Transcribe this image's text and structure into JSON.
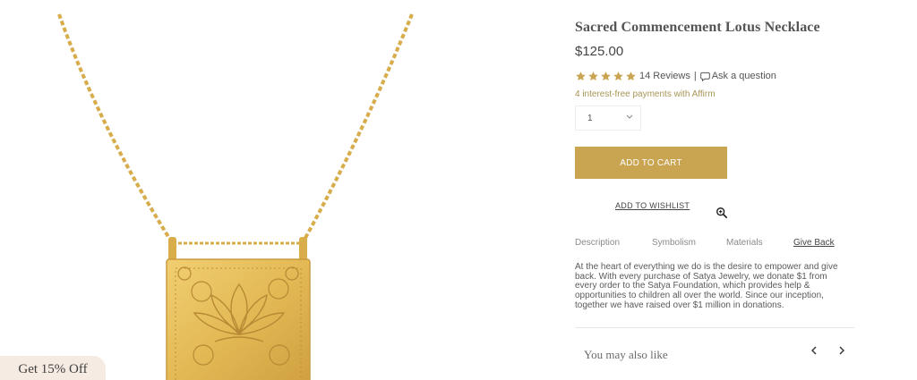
{
  "product": {
    "title": "Sacred Commencement Lotus Necklace",
    "price": "$125.00",
    "rating": 5,
    "reviews": "14 Reviews",
    "separator": "|",
    "ask_question": "Ask a question",
    "affirm_text": "4 interest-free payments with Affirm",
    "quantity": "1",
    "add_to_cart": "ADD TO CART",
    "add_to_wishlist": "ADD TO WISHLIST"
  },
  "tabs": [
    {
      "label": "Description"
    },
    {
      "label": "Symbolism"
    },
    {
      "label": "Materials"
    },
    {
      "label": "Give Back"
    }
  ],
  "active_tab": "Give Back",
  "tab_content": [
    "At the heart of everything we do is the desire to empower and give",
    "back. With every purchase of Satya Jewelry, we donate $1 from",
    "every order to the Satya Foundation, which provides help &",
    "opportunities to children all over the world. Since our inception,",
    "together we have raised over $1 million in donations."
  ],
  "recommendations": {
    "title": "You may also like"
  },
  "promo": {
    "label": "Get 15% Off"
  },
  "icons": {
    "star": "star-icon",
    "chat": "chat-bubble-icon",
    "chevron": "chevron-down-icon",
    "zoom": "zoom-in-icon",
    "prev": "chevron-left-icon",
    "next": "chevron-right-icon"
  },
  "colors": {
    "gold": "#c9a451",
    "star": "#c9a451",
    "affirm": "#a99557",
    "promo_bg": "#f6ebe2"
  }
}
